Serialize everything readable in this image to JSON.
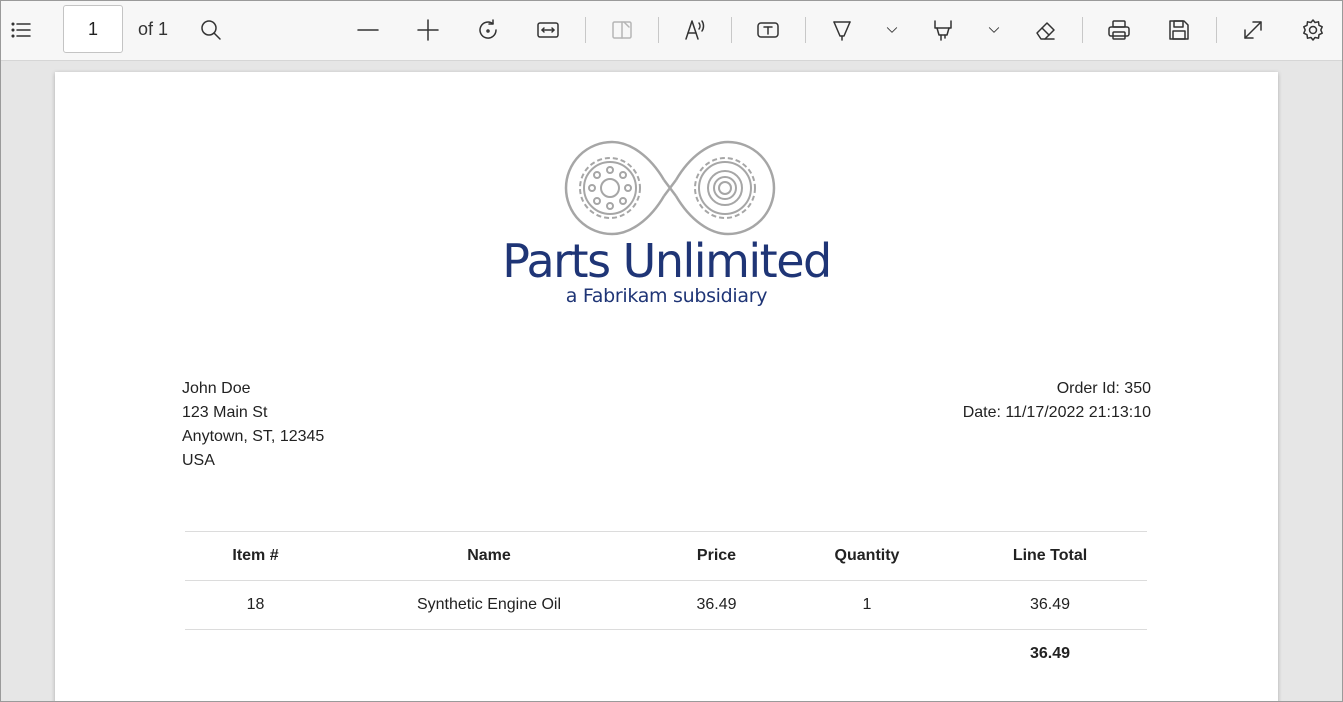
{
  "toolbar": {
    "page_number": "1",
    "page_total": "of 1",
    "icons": [
      "contents-icon",
      "search-icon",
      "zoom-out-icon",
      "zoom-in-icon",
      "rotate-icon",
      "fit-width-icon",
      "page-view-icon",
      "read-aloud-icon",
      "text-box-icon",
      "draw-icon",
      "highlight-icon",
      "erase-icon",
      "print-icon",
      "save-icon",
      "fullscreen-icon",
      "settings-icon"
    ]
  },
  "document": {
    "brand": {
      "name": "Parts Unlimited",
      "subtitle": "a Fabrikam subsidiary",
      "logo_color": "#a6a6a6",
      "text_color": "#1f3576"
    },
    "customer": {
      "name": "John Doe",
      "street": "123 Main St",
      "city_line": "Anytown, ST, 12345",
      "country": "USA"
    },
    "order": {
      "id_line": "Order Id: 350",
      "date_line": "Date: 11/17/2022 21:13:10"
    },
    "table": {
      "headers": [
        "Item #",
        "Name",
        "Price",
        "Quantity",
        "Line Total"
      ],
      "rows": [
        {
          "item": "18",
          "name": "Synthetic Engine Oil",
          "price": "36.49",
          "quantity": "1",
          "line_total": "36.49"
        }
      ],
      "total": "36.49"
    }
  }
}
